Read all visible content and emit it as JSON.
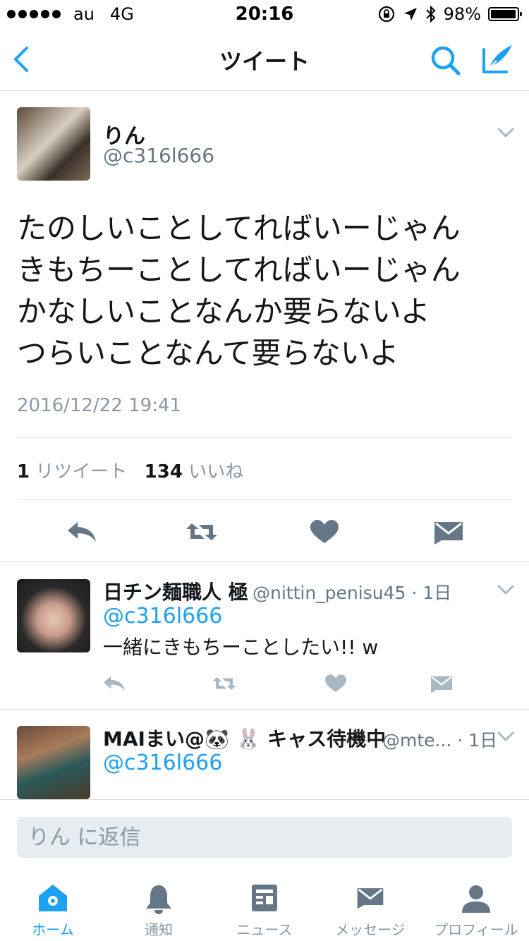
{
  "status_bar": {
    "carrier": "au",
    "network": "4G",
    "time": "20:16",
    "battery": "98%",
    "signal_icon": "signal-dots-icon",
    "lock_icon": "rotation-lock-icon",
    "location_icon": "location-arrow-icon",
    "bluetooth_icon": "bluetooth-icon",
    "battery_icon": "battery-icon"
  },
  "nav": {
    "title": "ツイート",
    "back_icon": "chevron-left-icon",
    "search_icon": "search-icon",
    "compose_icon": "compose-tweet-icon"
  },
  "tweet": {
    "name": "りん",
    "handle": "@c316l666",
    "text": "たのしいことしてればいーじゃん\nきもちーことしてればいーじゃん\nかなしいことなんか要らないよ\nつらいことなんて要らないよ",
    "timestamp": "2016/12/22 19:41",
    "retweet_count": "1",
    "retweet_label": "リツイート",
    "like_count": "134",
    "like_label": "いいね"
  },
  "replies": [
    {
      "name": "日チン麺職人 極",
      "handle": "@nittin_penisu45",
      "age": "· 1日",
      "mention": "@c316l666",
      "text": "一緒にきもちーことしたい!! w"
    },
    {
      "name": "MAIまい@🐼 🐰 キャス待機中",
      "handle": "@mte...",
      "age": "· 1日",
      "mention": "@c316l666",
      "text": ""
    }
  ],
  "reply_box": {
    "placeholder": "りん に返信"
  },
  "tabs": [
    {
      "label": "ホーム",
      "icon": "home-icon",
      "active": true
    },
    {
      "label": "通知",
      "icon": "bell-icon",
      "active": false
    },
    {
      "label": "ニュース",
      "icon": "news-icon",
      "active": false
    },
    {
      "label": "メッセージ",
      "icon": "envelope-icon",
      "active": false
    },
    {
      "label": "プロフィール",
      "icon": "profile-icon",
      "active": false
    }
  ],
  "colors": {
    "accent": "#1da1f2",
    "text": "#14171a",
    "secondary": "#657786",
    "icon_gray": "#8899a6",
    "input_bg": "#e6ecf0"
  }
}
